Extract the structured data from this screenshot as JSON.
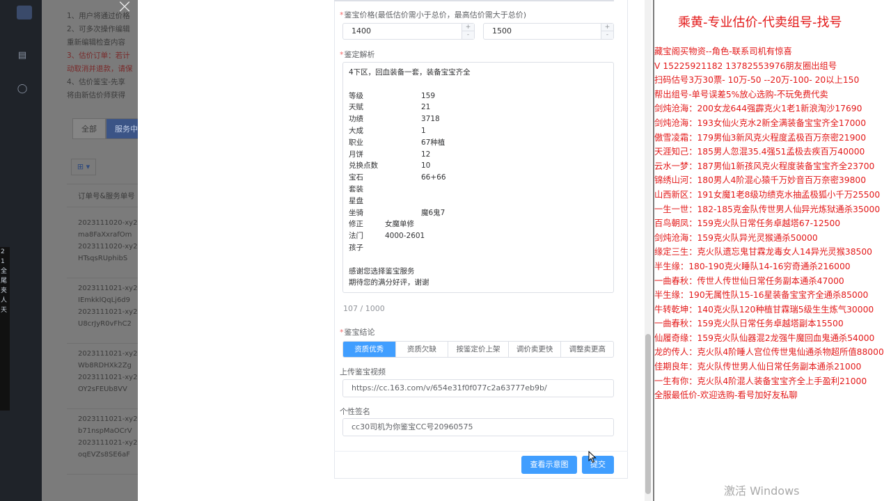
{
  "rail": {
    "icons": [
      "document-icon",
      "user-icon"
    ],
    "strip_text": [
      "2",
      "1",
      "全",
      "尾",
      "夹",
      "人",
      "天"
    ]
  },
  "background": {
    "notes": [
      "1、用户将通过价格",
      "2、可多次操作编辑",
      "重新编辑检查内容",
      "3、估价订单：若计",
      "动取消并退款，请保",
      "4、估价鉴宝-先享",
      "将由新估价师获得"
    ],
    "tabs": [
      {
        "label": "全部",
        "active": false
      },
      {
        "label": "服务中",
        "active": true
      }
    ],
    "grid_button": "⊞ ▾",
    "column_header": "订单号&服务单号",
    "rows": [
      [
        "2023111020-xy2",
        "ma8FaXxrafOm",
        "2023111020-xy2",
        "HTsqsRUphibS"
      ],
      [
        "2023111021-xy2",
        "IEmkklQqLj6d9",
        "2023111021-xy2",
        "U8crJyR0vFhC2"
      ],
      [
        "2023111021-xy2",
        "Wb8RDHXk2Zg",
        "2023111021-xy2",
        "OY2sFEUb8VV"
      ],
      [
        "2023111021-xy2",
        "b71nspMaOCrV",
        "2023111021-xy2",
        "oqEVZs8SE6aF"
      ]
    ]
  },
  "modal": {
    "close": "×",
    "price_label": "鉴宝价格(最低估价需小于总价，最高估价需大于总价)",
    "price_min": "1400",
    "price_max": "1500",
    "spin_up": "+",
    "spin_down": "-",
    "analysis_label": "鉴定解析",
    "analysis_intro": "4下区，回血装备一套，装备宝宝齐全",
    "analysis_fields": [
      {
        "k": "等级",
        "v": "159"
      },
      {
        "k": "天赋",
        "v": "21"
      },
      {
        "k": "功绩",
        "v": "3718"
      },
      {
        "k": "大成",
        "v": "1"
      },
      {
        "k": "职业",
        "v": "67种植"
      },
      {
        "k": "月饼",
        "v": "12"
      },
      {
        "k": "兑换点数",
        "v": "10"
      },
      {
        "k": "宝石",
        "v": "66+66"
      },
      {
        "k": "套装",
        "v": ""
      },
      {
        "k": "星盘",
        "v": ""
      },
      {
        "k": "坐骑",
        "v": "魔6鬼7"
      },
      {
        "k": "修正",
        "v": "女魔单修"
      },
      {
        "k": "法门",
        "v": "4000-2601"
      },
      {
        "k": "孩子",
        "v": ""
      }
    ],
    "analysis_outro": [
      "感谢您选择鉴宝服务",
      "期待您的满分好评，谢谢"
    ],
    "counter": "107 / 1000",
    "conclusion_label": "鉴宝结论",
    "conclusion_options": [
      {
        "label": "资质优秀",
        "selected": true
      },
      {
        "label": "资质欠缺",
        "selected": false
      },
      {
        "label": "按鉴定价上架",
        "selected": false
      },
      {
        "label": "调价卖更快",
        "selected": false
      },
      {
        "label": "调整卖更高",
        "selected": false
      }
    ],
    "video_label": "上传鉴宝视频",
    "video_value": "https://cc.163.com/v/654e31f0f077c2a63777eb9b/",
    "signature_label": "个性签名",
    "signature_value": "cc30司机为你鉴宝CC号20960575",
    "view_example_button": "查看示意图",
    "submit_button": "提交"
  },
  "overlay": {
    "title": "乘黄-专业估价-代卖组号-找号",
    "lines": [
      "藏宝阁买物资--角色-联系司机有惊喜",
      "V 15225921182  13782553976朋友圈出组号",
      "扫码估号3万30票- 10万-50 --20万-100- 20以上150",
      "帮出组号-单号误差5%放心选购-不玩免费代卖",
      "剑炖沧海：200女龙644强霹克火1老1新浪淘沙17690",
      "剑炖沧海：193女仙火克水2新全满装备宝宝齐全17000",
      "傲雪凌霜：179男仙3新风克火程度孟极百万奈密21900",
      "天涯知己：185男人忽混35.4强51孟极去疾百万40000",
      "云水一梦：187男仙1新孩风克火程度装备宝宝齐全23700",
      "锦绣山河：180男人4阶混心猿千万妙音百万奈密39800",
      "山西新区：191女魔1老8级功绩克水抽孟极狐小千万25500",
      "一生一世：182-185克金队传世男人仙异光炼狱通杀35000",
      "百鸟朝凤：159克火队日常任务卓越塔67-12500",
      "剑炖沧海：159克火队异光灵猴通杀50000",
      "缘定三生：克火队遗忘鬼甘霖龙毒女人14异光灵猴38500",
      "半生缘：180-190克火睡队14-16穷奇通杀216000",
      "一曲春秋：传世人传世仙日常任务副本通杀47000",
      "半生缘：190无属性队15-16星装备宝宝齐全通杀85000",
      "牛转乾坤：140克火队120种植甘霖瑞5级生生炼气30000",
      "一曲春秋：159克火队日常任务卓越塔副本15500",
      "仙履奇缘：159克火队仙器混2龙强牛魔回血鬼通杀54000",
      "龙的传人：克火队4阶睡人宫位传世鬼仙通杀物超所值88000",
      "佳期良年：克火队传世男人仙日常任务副本通杀21000",
      "一生有你：克火队4阶混人装备宝宝齐全上手盈利21000",
      "全服最低价-欢迎选购-看号加好友私聊"
    ],
    "watermark": "激活 Windows"
  }
}
